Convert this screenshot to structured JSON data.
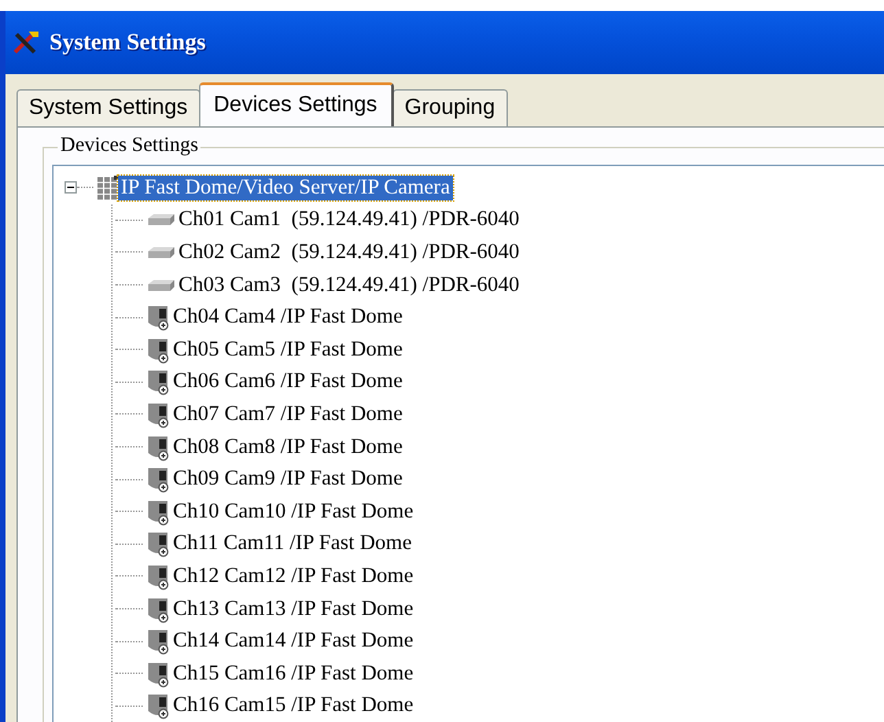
{
  "window": {
    "title": "System Settings"
  },
  "tabs": [
    {
      "label": "System Settings",
      "selected": false
    },
    {
      "label": "Devices Settings",
      "selected": true
    },
    {
      "label": "Grouping",
      "selected": false
    }
  ],
  "group": {
    "title": "Devices Settings"
  },
  "tree": [
    {
      "label": "IP Fast Dome/Video Server/IP Camera",
      "kind": "group",
      "selected": true,
      "expanded": true,
      "children": [
        {
          "label": "Ch01 Cam1  (59.124.49.41) /PDR-6040",
          "kind": "server",
          "selected": false
        },
        {
          "label": "Ch02 Cam2  (59.124.49.41) /PDR-6040",
          "kind": "server",
          "selected": false
        },
        {
          "label": "Ch03 Cam3  (59.124.49.41) /PDR-6040",
          "kind": "server",
          "selected": false
        },
        {
          "label": "Ch04 Cam4 /IP Fast Dome",
          "kind": "dome",
          "selected": false
        },
        {
          "label": "Ch05 Cam5 /IP Fast Dome",
          "kind": "dome",
          "selected": false
        },
        {
          "label": "Ch06 Cam6 /IP Fast Dome",
          "kind": "dome",
          "selected": false
        },
        {
          "label": "Ch07 Cam7 /IP Fast Dome",
          "kind": "dome",
          "selected": false
        },
        {
          "label": "Ch08 Cam8 /IP Fast Dome",
          "kind": "dome",
          "selected": false
        },
        {
          "label": "Ch09 Cam9 /IP Fast Dome",
          "kind": "dome",
          "selected": false
        },
        {
          "label": "Ch10 Cam10 /IP Fast Dome",
          "kind": "dome",
          "selected": false
        },
        {
          "label": "Ch11 Cam11 /IP Fast Dome",
          "kind": "dome",
          "selected": false
        },
        {
          "label": "Ch12 Cam12 /IP Fast Dome",
          "kind": "dome",
          "selected": false
        },
        {
          "label": "Ch13 Cam13 /IP Fast Dome",
          "kind": "dome",
          "selected": false
        },
        {
          "label": "Ch14 Cam14 /IP Fast Dome",
          "kind": "dome",
          "selected": false
        },
        {
          "label": "Ch15 Cam16 /IP Fast Dome",
          "kind": "dome",
          "selected": false
        },
        {
          "label": "Ch16 Cam15 /IP Fast Dome",
          "kind": "dome",
          "selected": false
        }
      ]
    }
  ]
}
